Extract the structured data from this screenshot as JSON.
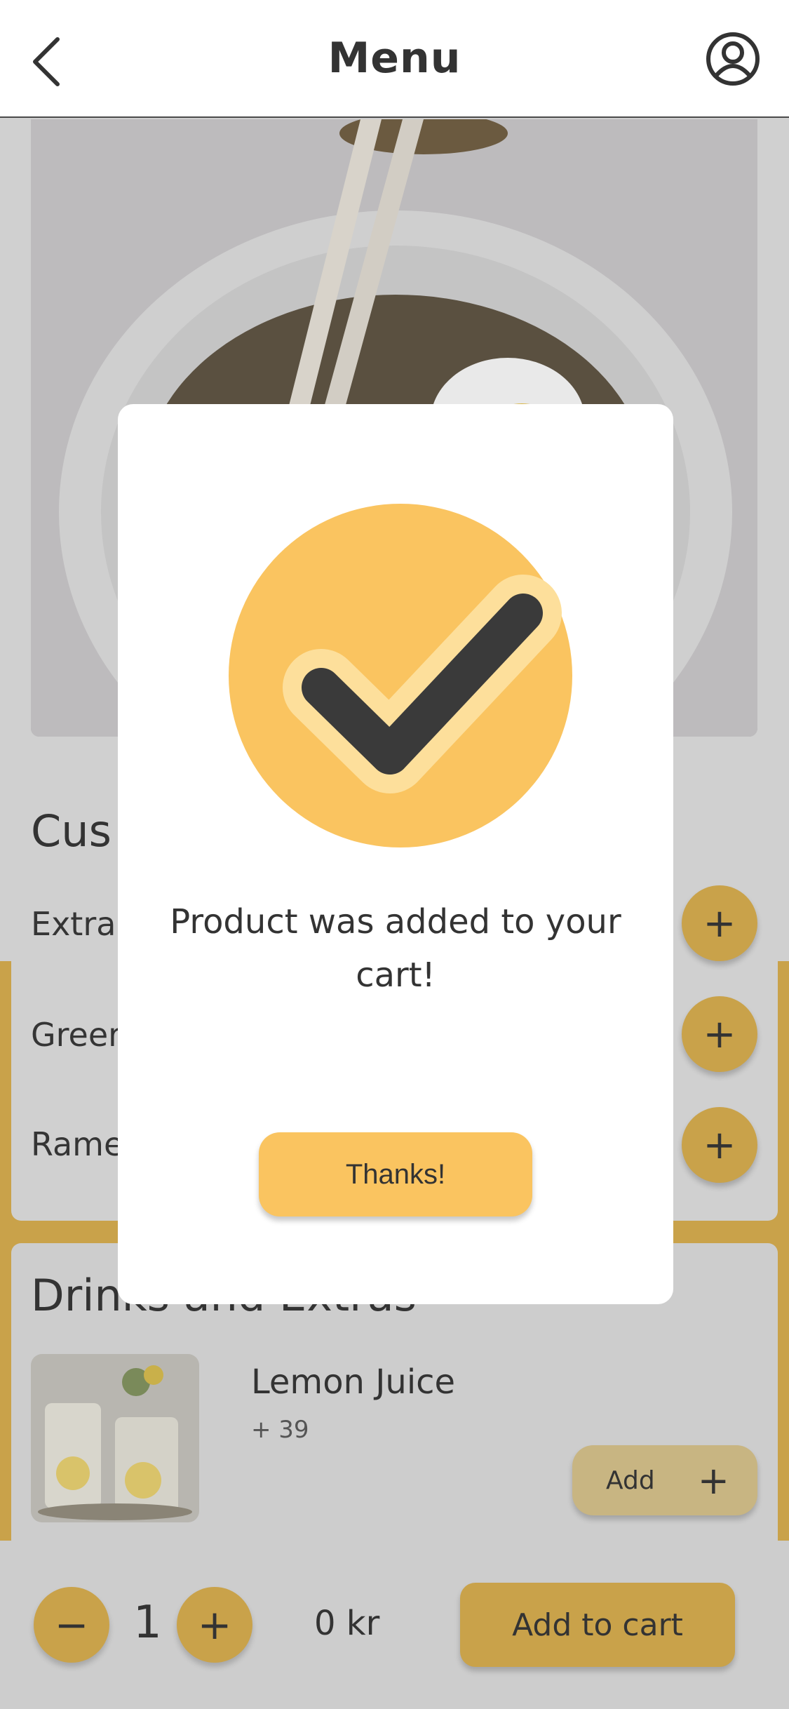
{
  "header": {
    "title": "Menu"
  },
  "customize": {
    "title": "Cus",
    "options": [
      {
        "label": "Extra"
      },
      {
        "label": "Greer"
      },
      {
        "label": "Rame"
      }
    ]
  },
  "drinks": {
    "title": "Drinks and Extras",
    "items": [
      {
        "name": "Lemon Juice",
        "price": "+ 39",
        "add_label": "Add"
      }
    ]
  },
  "bottom": {
    "quantity": "1",
    "total": "0 kr",
    "add_to_cart": "Add to cart"
  },
  "modal": {
    "message": "Product was added to your cart!",
    "button": "Thanks!"
  },
  "colors": {
    "accent": "#fac460",
    "accent_dimmed": "#c9a24a",
    "check_dark": "#3a3a3a",
    "check_outline": "#fddf9b"
  }
}
